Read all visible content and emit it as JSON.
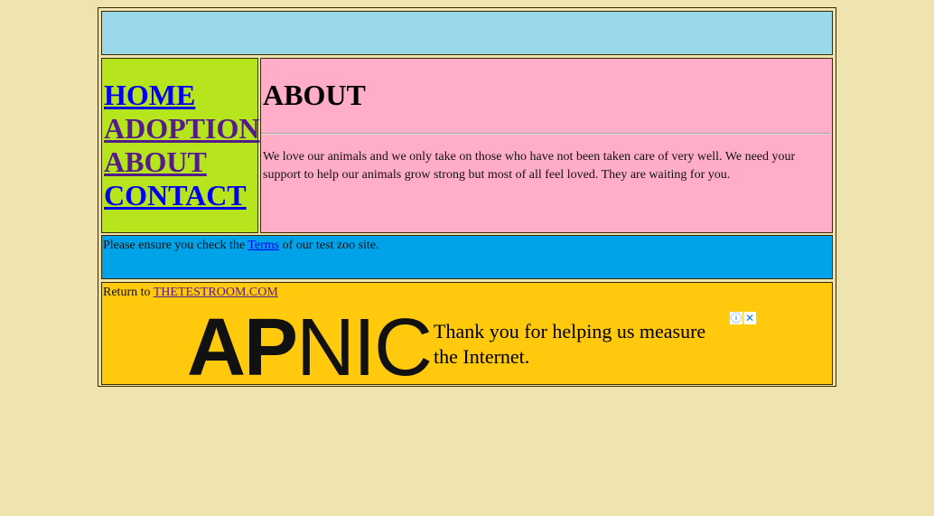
{
  "nav": {
    "items": [
      {
        "label": "HOME"
      },
      {
        "label": "ADOPTION"
      },
      {
        "label": "ABOUT"
      },
      {
        "label": "CONTACT"
      }
    ]
  },
  "main": {
    "heading": "ABOUT",
    "body": "We love our animals and we only take on those who have not been taken care of very well. We need your support to help our animals grow strong but most of all feel loved. They are waiting for you."
  },
  "terms": {
    "prefix": "Please ensure you check the ",
    "link": "Terms",
    "suffix": " of our test zoo site."
  },
  "footer": {
    "prefix": "Return to ",
    "link": "THETESTROOM.COM"
  },
  "ad": {
    "logo_bold": "AP",
    "logo_regular": "NIC",
    "tagline": "Thank you for helping us measure the Internet.",
    "info_icon": "info-icon",
    "close_icon": "close-icon"
  },
  "colors": {
    "page_bg": "#efe4b0",
    "header_bg": "#9bd9ea",
    "nav_bg": "#b6e51e",
    "content_bg": "#ffadc9",
    "terms_bg": "#00a2e8",
    "footer_bg": "#ffc90e"
  }
}
